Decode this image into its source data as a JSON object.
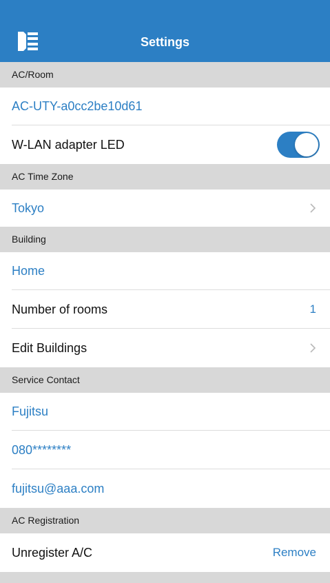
{
  "header": {
    "title": "Settings",
    "menu_icon": "sidebar-menu-icon",
    "background": "#2c7fc4"
  },
  "colors": {
    "accent": "#2c7fc4",
    "section_background": "#d8d8d8"
  },
  "sections": {
    "ac_room": {
      "header": "AC/Room",
      "device_name": "AC-UTY-a0cc2be10d61",
      "wlan_led_label": "W-LAN adapter LED",
      "wlan_led_enabled": true
    },
    "time_zone": {
      "header": "AC Time Zone",
      "value": "Tokyo"
    },
    "building": {
      "header": "Building",
      "name": "Home",
      "rooms_label": "Number of rooms",
      "rooms_value": "1",
      "edit_label": "Edit Buildings"
    },
    "service_contact": {
      "header": "Service Contact",
      "company": "Fujitsu",
      "phone": "080********",
      "email": "fujitsu@aaa.com"
    },
    "registration": {
      "header": "AC Registration",
      "unregister_label": "Unregister A/C",
      "remove_label": "Remove"
    }
  }
}
